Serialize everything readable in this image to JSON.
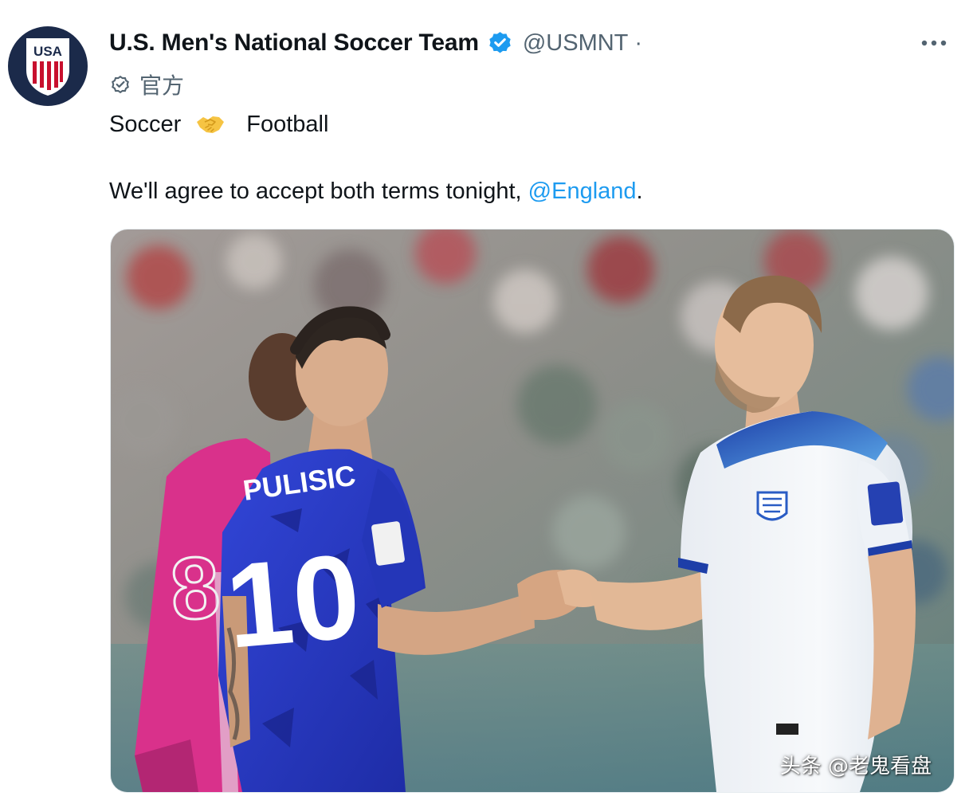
{
  "account": {
    "display_name": "U.S. Men's National Soccer Team",
    "handle": "@USMNT",
    "separator": "·",
    "affiliation_label": "官方",
    "avatar_text": "USA"
  },
  "tweet": {
    "line1_left": "Soccer",
    "line1_emoji": "handshake-emoji",
    "line1_right": "Football",
    "line2_text": "We'll agree to accept both terms tonight, ",
    "line2_mention": "@England",
    "line2_end": "."
  },
  "media": {
    "jersey_name": "PULISIC",
    "jersey_number": "10",
    "back_jersey_number": "8"
  },
  "watermark": "头条 @老鬼看盘",
  "colors": {
    "accent": "#1d9bf0",
    "secondary_text": "#536471",
    "avatar_bg": "#1b2a4a",
    "usa_blue": "#2e3fd0",
    "usa_pink": "#d6267f",
    "england_white": "#f4f6f9"
  },
  "icons": {
    "verified": "verified-badge-icon",
    "affiliation": "official-check-icon",
    "more": "more-dots-icon"
  }
}
